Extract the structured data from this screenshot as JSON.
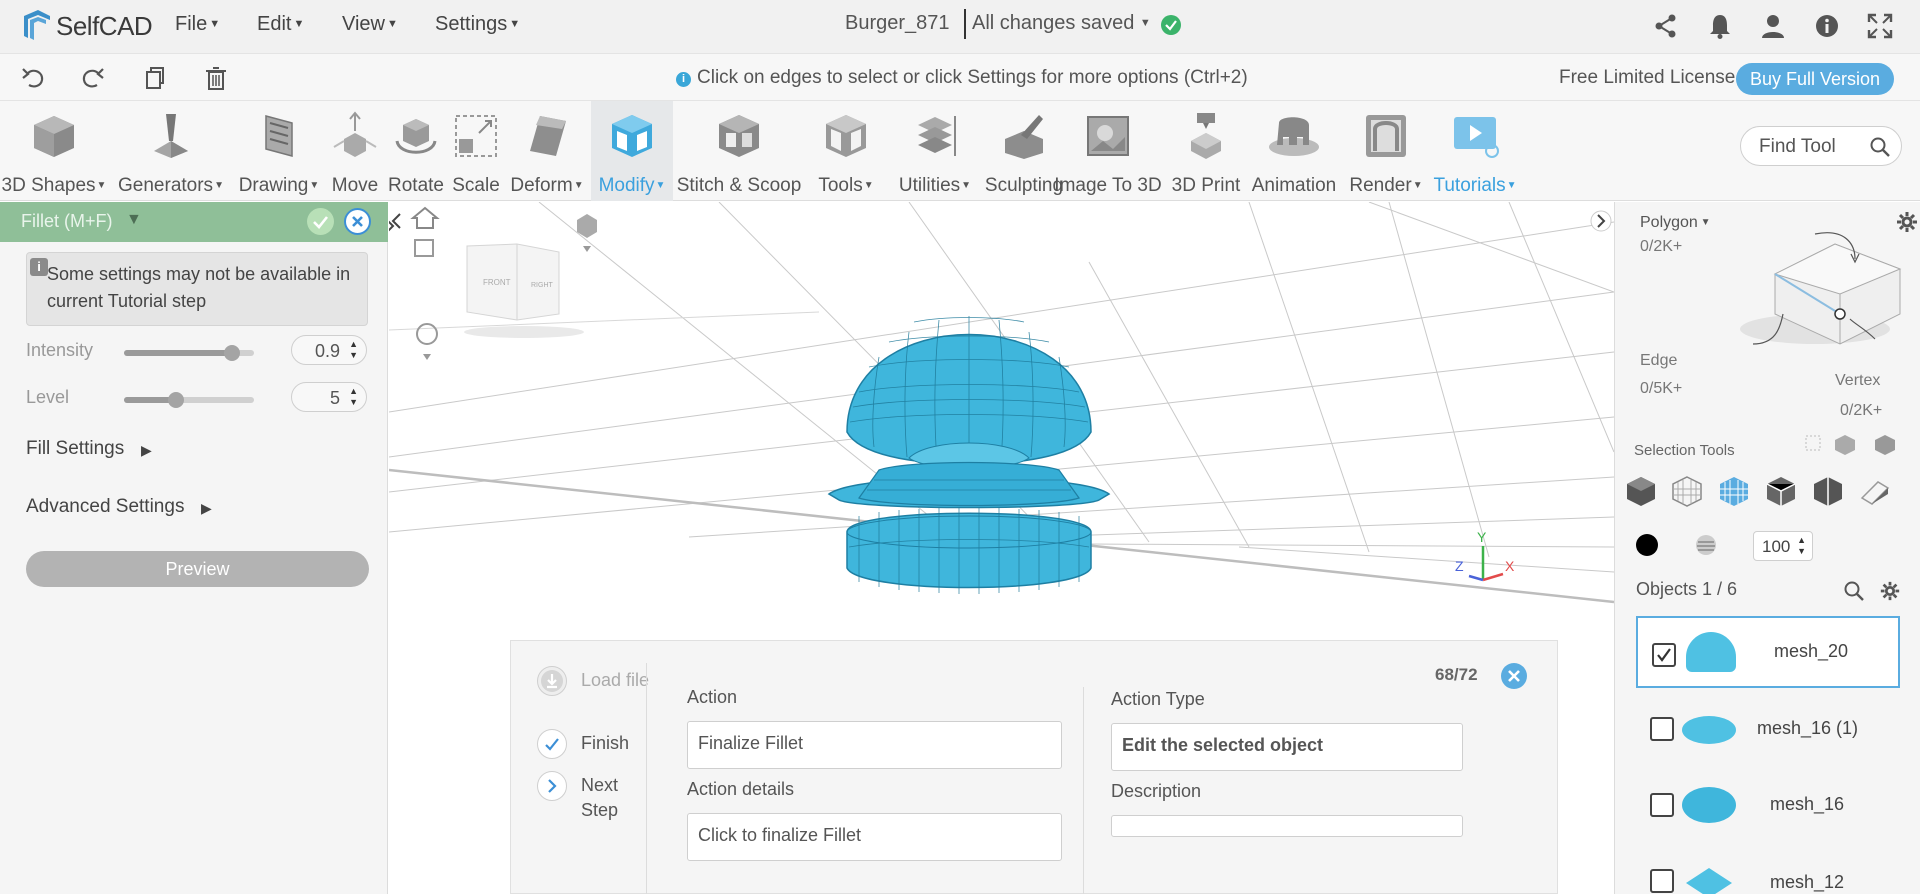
{
  "app": {
    "name": "SelfCAD"
  },
  "menu": {
    "items": [
      {
        "label": "File"
      },
      {
        "label": "Edit"
      },
      {
        "label": "View"
      },
      {
        "label": "Settings"
      }
    ]
  },
  "document": {
    "title": "Burger_871",
    "status": "All changes saved"
  },
  "hint": {
    "text": "Click on edges to select or click Settings for more options (Ctrl+2)"
  },
  "license": {
    "text": "Free Limited License",
    "buy_label": "Buy Full Version"
  },
  "toolbar": {
    "tools": [
      {
        "label": "3D Shapes",
        "dropdown": true
      },
      {
        "label": "Generators",
        "dropdown": true
      },
      {
        "label": "Drawing",
        "dropdown": true
      },
      {
        "label": "Move",
        "dropdown": false
      },
      {
        "label": "Rotate",
        "dropdown": false
      },
      {
        "label": "Scale",
        "dropdown": false
      },
      {
        "label": "Deform",
        "dropdown": true
      },
      {
        "label": "Modify",
        "dropdown": true
      },
      {
        "label": "Stitch & Scoop",
        "dropdown": false
      },
      {
        "label": "Tools",
        "dropdown": true
      },
      {
        "label": "Utilities",
        "dropdown": true
      },
      {
        "label": "Sculpting",
        "dropdown": false
      },
      {
        "label": "Image To 3D",
        "dropdown": false
      },
      {
        "label": "3D Print",
        "dropdown": false
      },
      {
        "label": "Animation",
        "dropdown": false
      },
      {
        "label": "Render",
        "dropdown": true
      },
      {
        "label": "Tutorials",
        "dropdown": true
      }
    ],
    "find_tool": "Find Tool"
  },
  "fillet_panel": {
    "title": "Fillet (M+F)",
    "note": "Some settings may not be available in current Tutorial step",
    "intensity": {
      "label": "Intensity",
      "value": "0.9",
      "fraction": 0.83
    },
    "level": {
      "label": "Level",
      "value": "5",
      "fraction": 0.4
    },
    "fill_settings": "Fill Settings",
    "advanced_settings": "Advanced Settings",
    "preview": "Preview"
  },
  "tutorial": {
    "steps": [
      {
        "label": "Load file"
      },
      {
        "label": "Finish"
      },
      {
        "label": "Next Step"
      }
    ],
    "counter": "68/72",
    "action_label": "Action",
    "action_value": "Finalize Fillet",
    "action_details_label": "Action details",
    "action_details_value": "Click to finalize Fillet",
    "action_type_label": "Action Type",
    "action_type_value": "Edit the selected object",
    "description_label": "Description",
    "description_value": ""
  },
  "selection": {
    "mode": "Polygon",
    "polygon_count": "0/2K+",
    "edge_label": "Edge",
    "edge_count": "0/5K+",
    "vertex_label": "Vertex",
    "vertex_count": "0/2K+",
    "tools_label": "Selection Tools",
    "opacity": "100"
  },
  "viewcube": {
    "front": "FRONT",
    "right": "RIGHT"
  },
  "axes": {
    "x": "X",
    "y": "Y",
    "z": "Z"
  },
  "objects": {
    "header": "Objects 1 / 6",
    "items": [
      {
        "name": "mesh_20",
        "checked": true
      },
      {
        "name": "mesh_16 (1)",
        "checked": false
      },
      {
        "name": "mesh_16",
        "checked": false
      },
      {
        "name": "mesh_12",
        "checked": false
      }
    ]
  },
  "colors": {
    "accent": "#5aace0",
    "model": "#3fb6dc",
    "panel_header": "#8fbf98",
    "status_ok": "#3bb36a"
  }
}
